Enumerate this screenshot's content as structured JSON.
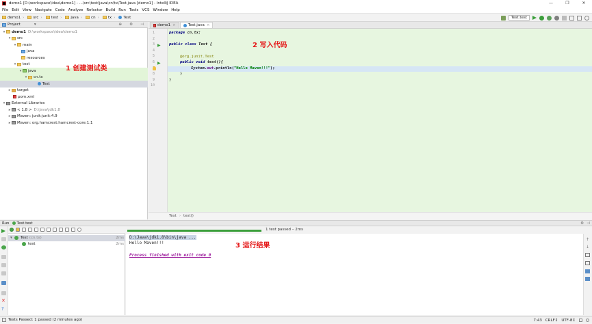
{
  "window": {
    "title": "demo1 [D:\\workspace\\idea\\demo1] - ...\\src\\test\\java\\cn\\tx\\Test.java [demo1] - IntelliJ IDEA",
    "controls": [
      "—",
      "❐",
      "✕"
    ]
  },
  "menu": [
    "File",
    "Edit",
    "View",
    "Navigate",
    "Code",
    "Analyze",
    "Refactor",
    "Build",
    "Run",
    "Tools",
    "VCS",
    "Window",
    "Help"
  ],
  "breadcrumb": [
    "demo1",
    "src",
    "test",
    "java",
    "cn",
    "tx",
    "Test"
  ],
  "run_config": "Test.test",
  "project": {
    "header": "Project",
    "tree": [
      {
        "label": "demo1",
        "path": "D:\\workspace\\idea\\demo1",
        "arrow": "▾",
        "type": "module"
      },
      {
        "label": "src",
        "path": "",
        "arrow": "▾",
        "type": "folder"
      },
      {
        "label": "main",
        "path": "",
        "arrow": "▾",
        "type": "folder"
      },
      {
        "label": "java",
        "path": "",
        "arrow": "",
        "type": "src"
      },
      {
        "label": "resources",
        "path": "",
        "arrow": "",
        "type": "folder"
      },
      {
        "label": "test",
        "path": "",
        "arrow": "▾",
        "type": "folder"
      },
      {
        "label": "java",
        "path": "",
        "arrow": "▾",
        "type": "testsrc"
      },
      {
        "label": "cn.tx",
        "path": "",
        "arrow": "▾",
        "type": "folder"
      },
      {
        "label": "Test",
        "path": "",
        "arrow": "",
        "type": "class"
      },
      {
        "label": "target",
        "path": "",
        "arrow": "▸",
        "type": "folder"
      },
      {
        "label": "pom.xml",
        "path": "",
        "arrow": "",
        "type": "file"
      },
      {
        "label": "External Libraries",
        "path": "",
        "arrow": "▾",
        "type": "lib"
      },
      {
        "label": "< 1.8 >",
        "path": "D:\\Java\\jdk1.8",
        "arrow": "▸",
        "type": "lib"
      },
      {
        "label": "Maven: junit:junit:4.9",
        "path": "",
        "arrow": "▸",
        "type": "lib"
      },
      {
        "label": "Maven: org.hamcrest:hamcrest-core:1.1",
        "path": "",
        "arrow": "▸",
        "type": "lib"
      }
    ]
  },
  "annotations": {
    "create": "1 创建测试类",
    "write": "2 写入代码",
    "result": "3 运行结果"
  },
  "tabs": [
    {
      "label": "demo1",
      "active": false
    },
    {
      "label": "Test.java",
      "active": true
    }
  ],
  "code": {
    "line_numbers": [
      "1",
      "2",
      "3",
      "4",
      "5",
      "6",
      "7",
      "8",
      "9",
      "10"
    ],
    "package_kw": "package",
    "package_name": " cn.tx;",
    "class_kw": "public class",
    "class_name": " Test {",
    "annotation": "@org.junit.Test",
    "method_kw": "public void",
    "method_name": " test(){",
    "print_a": "System.",
    "print_out": "out",
    "print_b": ".println(",
    "print_str": "\"Hello Maven!!!\"",
    "print_c": ");",
    "close_method": "}",
    "close_class": "}"
  },
  "editor_breadcrumb": [
    "Test",
    "test()"
  ],
  "run": {
    "header": "Run",
    "config": "Test.test",
    "pass_text": "1 test passed – 2ms",
    "tests": [
      {
        "label": "Test",
        "sub": "(cn.tx)",
        "time": "2ms"
      },
      {
        "label": "test",
        "sub": "",
        "time": "2ms"
      }
    ],
    "console": {
      "cmd": "D:\\Java\\jdk1.8\\bin\\java ...",
      "out": "Hello Maven!!!",
      "exit": "Process finished with exit code 0"
    }
  },
  "status": {
    "left": "Tests Passed: 1 passed (2 minutes ago)",
    "pos": "7:43",
    "crlf": "CRLF↕",
    "enc": "UTF-8↕"
  },
  "colors": {
    "green": "#3a9e3a",
    "annotation": "#e51818",
    "editor_bg": "#e7f6e0"
  }
}
